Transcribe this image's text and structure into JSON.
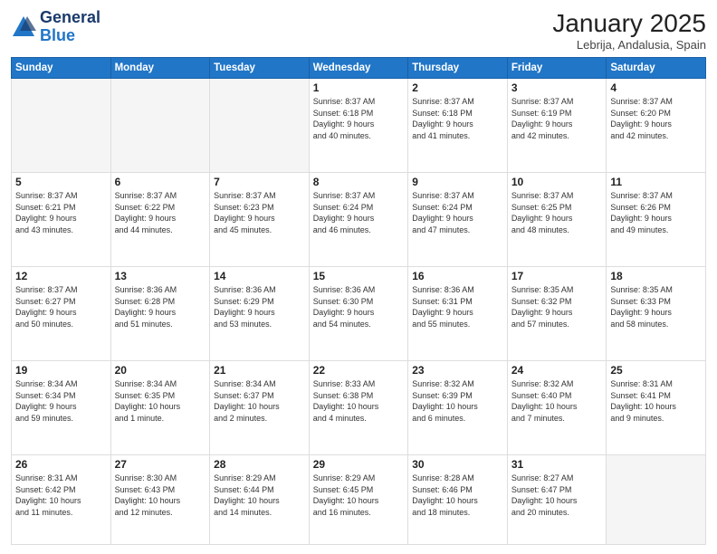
{
  "header": {
    "logo_general": "General",
    "logo_blue": "Blue",
    "month_title": "January 2025",
    "location": "Lebrija, Andalusia, Spain"
  },
  "weekdays": [
    "Sunday",
    "Monday",
    "Tuesday",
    "Wednesday",
    "Thursday",
    "Friday",
    "Saturday"
  ],
  "weeks": [
    [
      {
        "day": "",
        "info": ""
      },
      {
        "day": "",
        "info": ""
      },
      {
        "day": "",
        "info": ""
      },
      {
        "day": "1",
        "info": "Sunrise: 8:37 AM\nSunset: 6:18 PM\nDaylight: 9 hours\nand 40 minutes."
      },
      {
        "day": "2",
        "info": "Sunrise: 8:37 AM\nSunset: 6:18 PM\nDaylight: 9 hours\nand 41 minutes."
      },
      {
        "day": "3",
        "info": "Sunrise: 8:37 AM\nSunset: 6:19 PM\nDaylight: 9 hours\nand 42 minutes."
      },
      {
        "day": "4",
        "info": "Sunrise: 8:37 AM\nSunset: 6:20 PM\nDaylight: 9 hours\nand 42 minutes."
      }
    ],
    [
      {
        "day": "5",
        "info": "Sunrise: 8:37 AM\nSunset: 6:21 PM\nDaylight: 9 hours\nand 43 minutes."
      },
      {
        "day": "6",
        "info": "Sunrise: 8:37 AM\nSunset: 6:22 PM\nDaylight: 9 hours\nand 44 minutes."
      },
      {
        "day": "7",
        "info": "Sunrise: 8:37 AM\nSunset: 6:23 PM\nDaylight: 9 hours\nand 45 minutes."
      },
      {
        "day": "8",
        "info": "Sunrise: 8:37 AM\nSunset: 6:24 PM\nDaylight: 9 hours\nand 46 minutes."
      },
      {
        "day": "9",
        "info": "Sunrise: 8:37 AM\nSunset: 6:24 PM\nDaylight: 9 hours\nand 47 minutes."
      },
      {
        "day": "10",
        "info": "Sunrise: 8:37 AM\nSunset: 6:25 PM\nDaylight: 9 hours\nand 48 minutes."
      },
      {
        "day": "11",
        "info": "Sunrise: 8:37 AM\nSunset: 6:26 PM\nDaylight: 9 hours\nand 49 minutes."
      }
    ],
    [
      {
        "day": "12",
        "info": "Sunrise: 8:37 AM\nSunset: 6:27 PM\nDaylight: 9 hours\nand 50 minutes."
      },
      {
        "day": "13",
        "info": "Sunrise: 8:36 AM\nSunset: 6:28 PM\nDaylight: 9 hours\nand 51 minutes."
      },
      {
        "day": "14",
        "info": "Sunrise: 8:36 AM\nSunset: 6:29 PM\nDaylight: 9 hours\nand 53 minutes."
      },
      {
        "day": "15",
        "info": "Sunrise: 8:36 AM\nSunset: 6:30 PM\nDaylight: 9 hours\nand 54 minutes."
      },
      {
        "day": "16",
        "info": "Sunrise: 8:36 AM\nSunset: 6:31 PM\nDaylight: 9 hours\nand 55 minutes."
      },
      {
        "day": "17",
        "info": "Sunrise: 8:35 AM\nSunset: 6:32 PM\nDaylight: 9 hours\nand 57 minutes."
      },
      {
        "day": "18",
        "info": "Sunrise: 8:35 AM\nSunset: 6:33 PM\nDaylight: 9 hours\nand 58 minutes."
      }
    ],
    [
      {
        "day": "19",
        "info": "Sunrise: 8:34 AM\nSunset: 6:34 PM\nDaylight: 9 hours\nand 59 minutes."
      },
      {
        "day": "20",
        "info": "Sunrise: 8:34 AM\nSunset: 6:35 PM\nDaylight: 10 hours\nand 1 minute."
      },
      {
        "day": "21",
        "info": "Sunrise: 8:34 AM\nSunset: 6:37 PM\nDaylight: 10 hours\nand 2 minutes."
      },
      {
        "day": "22",
        "info": "Sunrise: 8:33 AM\nSunset: 6:38 PM\nDaylight: 10 hours\nand 4 minutes."
      },
      {
        "day": "23",
        "info": "Sunrise: 8:32 AM\nSunset: 6:39 PM\nDaylight: 10 hours\nand 6 minutes."
      },
      {
        "day": "24",
        "info": "Sunrise: 8:32 AM\nSunset: 6:40 PM\nDaylight: 10 hours\nand 7 minutes."
      },
      {
        "day": "25",
        "info": "Sunrise: 8:31 AM\nSunset: 6:41 PM\nDaylight: 10 hours\nand 9 minutes."
      }
    ],
    [
      {
        "day": "26",
        "info": "Sunrise: 8:31 AM\nSunset: 6:42 PM\nDaylight: 10 hours\nand 11 minutes."
      },
      {
        "day": "27",
        "info": "Sunrise: 8:30 AM\nSunset: 6:43 PM\nDaylight: 10 hours\nand 12 minutes."
      },
      {
        "day": "28",
        "info": "Sunrise: 8:29 AM\nSunset: 6:44 PM\nDaylight: 10 hours\nand 14 minutes."
      },
      {
        "day": "29",
        "info": "Sunrise: 8:29 AM\nSunset: 6:45 PM\nDaylight: 10 hours\nand 16 minutes."
      },
      {
        "day": "30",
        "info": "Sunrise: 8:28 AM\nSunset: 6:46 PM\nDaylight: 10 hours\nand 18 minutes."
      },
      {
        "day": "31",
        "info": "Sunrise: 8:27 AM\nSunset: 6:47 PM\nDaylight: 10 hours\nand 20 minutes."
      },
      {
        "day": "",
        "info": ""
      }
    ]
  ]
}
